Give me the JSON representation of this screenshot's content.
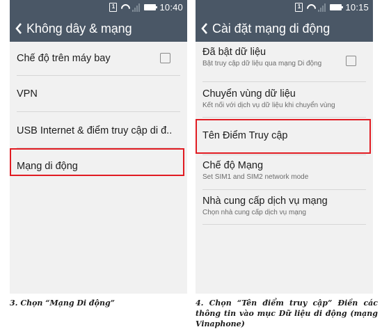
{
  "left_screen": {
    "status": {
      "time": "10:40",
      "sim_label": "1"
    },
    "title": "Không dây & mạng",
    "items": [
      {
        "label": "Chế độ trên máy bay",
        "has_checkbox": true,
        "checked": false
      },
      {
        "label": "VPN"
      },
      {
        "label": "USB Internet & điểm truy cập di đ.."
      },
      {
        "label": "Mạng di động",
        "highlighted": true
      }
    ],
    "caption": "3.  Chọn “Mạng Di động”"
  },
  "right_screen": {
    "status": {
      "time": "10:15",
      "sim_label": "1"
    },
    "title": "Cài đặt mạng di động",
    "items": [
      {
        "label": "Đã bật dữ liệu",
        "sub": "Bật truy cập dữ liệu qua mạng Di động",
        "has_checkbox": true,
        "checked": false
      },
      {
        "label": "Chuyển vùng dữ liệu",
        "sub": "Kết nối với dịch vụ dữ liệu khi chuyển vùng"
      },
      {
        "label": "Tên Điểm Truy cập",
        "highlighted": true
      },
      {
        "label": "Chế độ Mạng",
        "sub": "Set SIM1 and SIM2 network mode"
      },
      {
        "label": "Nhà cung cấp dịch vụ mạng",
        "sub": "Chọn nhà cung cấp dịch vụ mạng"
      }
    ],
    "caption": "4.  Chọn “Tên điểm truy cập” Điền các thông tin vào mục Dữ liệu di động (mạng Vinaphone)"
  },
  "colors": {
    "bar": "#4a5766",
    "screen_bg": "#f1f1f1",
    "highlight": "#e11b22",
    "divider": "#d6d6d6"
  },
  "icons": [
    "sim-icon",
    "wifi-icon",
    "signal-icon",
    "battery-icon",
    "back-arrow-icon"
  ]
}
